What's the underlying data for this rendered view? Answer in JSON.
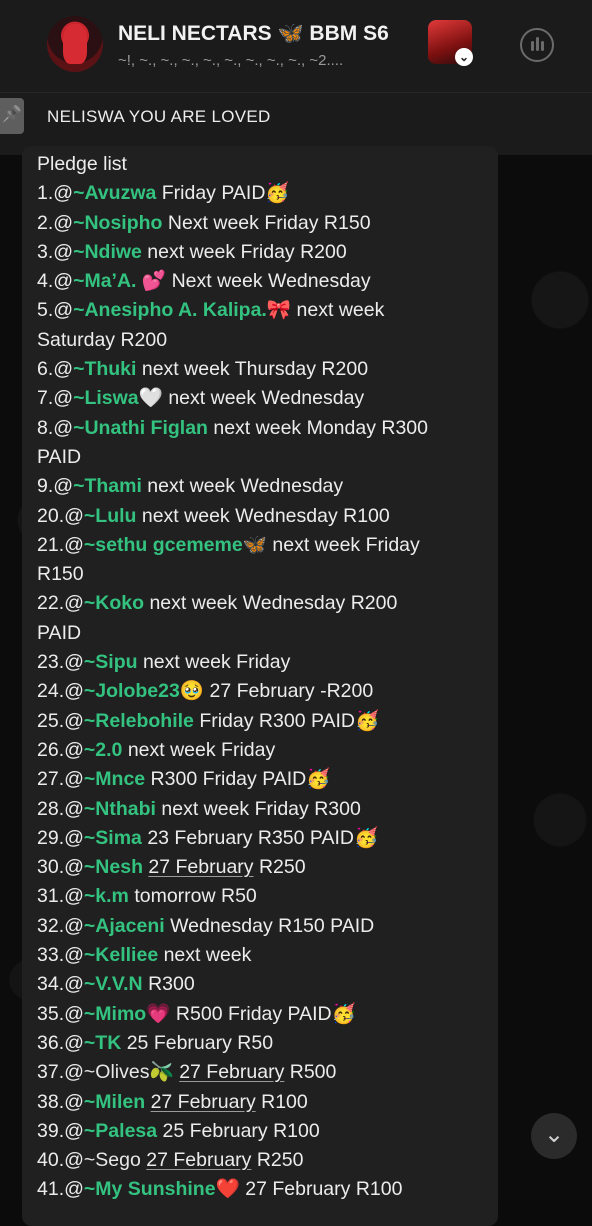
{
  "header": {
    "title": "NELI NECTARS 🦋 BBM S6",
    "subtitle": "~!, ~., ~., ~., ~., ~., ~., ~., ~., ~2....",
    "stack_badge": "⌄"
  },
  "pinned": {
    "text": "NELISWA YOU ARE LOVED"
  },
  "message": {
    "heading": "Pledge list",
    "lines": [
      {
        "num": "1.@",
        "name": "~Avuzwa",
        "rest": "  Friday PAID🥳"
      },
      {
        "num": "2.@",
        "name": "~Nosipho",
        "rest": "  Next week Friday R150"
      },
      {
        "num": "3.@",
        "name": "~Ndiwe",
        "rest": "  next week Friday R200"
      },
      {
        "num": "4.@",
        "name": "~Ma’A. 💕",
        "rest": "  Next week Wednesday"
      },
      {
        "num": "5.@",
        "name": "~Anesipho A. Kalipa.🎀",
        "rest": "  next week"
      },
      {
        "num": "",
        "name": "",
        "rest": "Saturday R200"
      },
      {
        "num": "6.@",
        "name": "~Thuki",
        "rest": "  next week Thursday R200"
      },
      {
        "num": "7.@",
        "name": "~Liswa🤍",
        "rest": "  next week Wednesday"
      },
      {
        "num": "8.@",
        "name": "~Unathi Figlan",
        "rest": " next week Monday R300"
      },
      {
        "num": "",
        "name": "",
        "rest": "PAID"
      },
      {
        "num": "9.@",
        "name": "~Thami",
        "rest": "  next week Wednesday"
      },
      {
        "num": "20.@",
        "name": "~Lulu",
        "rest": "  next week Wednesday R100"
      },
      {
        "num": "21.@",
        "name": "~sethu gcememe🦋",
        "rest": "  next week Friday"
      },
      {
        "num": "",
        "name": "",
        "rest": "R150"
      },
      {
        "num": "22.@",
        "name": "~Koko",
        "rest": "  next week Wednesday R200"
      },
      {
        "num": "",
        "name": "",
        "rest": "PAID"
      },
      {
        "num": "23.@",
        "name": "~Sipu",
        "rest": "  next week Friday"
      },
      {
        "num": "24.@",
        "name": "~Jolobe23🥹",
        "rest": " 27 February -R200"
      },
      {
        "num": "25.@",
        "name": "~Relebohile",
        "rest": " Friday R300 PAID🥳"
      },
      {
        "num": "26.@",
        "name": "~2.0",
        "rest": " next week Friday"
      },
      {
        "num": "27.@",
        "name": "~Mnce",
        "rest": " R300 Friday PAID🥳"
      },
      {
        "num": "28.@",
        "name": "~Nthabi",
        "rest": " next week Friday R300"
      },
      {
        "num": "29.@",
        "name": "~Sima",
        "rest": " 23 February R350 PAID🥳"
      },
      {
        "num": "30.@",
        "name": "~Nesh",
        "rest": " ",
        "u": "27 February",
        "after": " R250"
      },
      {
        "num": "31.@",
        "name": "~k.m",
        "rest": " tomorrow R50"
      },
      {
        "num": "32.@",
        "name": "~Ajaceni",
        "rest": " Wednesday R150 PAID"
      },
      {
        "num": "33.@",
        "name": "~Kelliee",
        "rest": " next week"
      },
      {
        "num": "34.@",
        "name": "~V.V.N",
        "rest": " R300"
      },
      {
        "num": "35.@",
        "name": "~Mimo💗",
        "rest": "  R500 Friday PAID🥳"
      },
      {
        "num": "36.@",
        "name": "~TK",
        "rest": " 25 February R50"
      },
      {
        "num": "37.@",
        "name": "~Olives🫒",
        "plain": true,
        "rest": " ",
        "u": "27 February",
        "after": " R500"
      },
      {
        "num": "38.@",
        "name": "~Milen",
        "rest": "  ",
        "u": "27 February",
        "after": " R100"
      },
      {
        "num": "39.@",
        "name": "~Palesa",
        "rest": "  25 February R100"
      },
      {
        "num": "40.@",
        "name": "~Sego",
        "plain": true,
        "rest": "  ",
        "u": "27 February",
        "after": " R250"
      },
      {
        "num": "41.@",
        "name": "~My Sunshine❤️",
        "rest": "  27 February R100"
      }
    ]
  },
  "scroll_button": {
    "icon": "chevron-down-icon",
    "glyph": "⌄"
  }
}
